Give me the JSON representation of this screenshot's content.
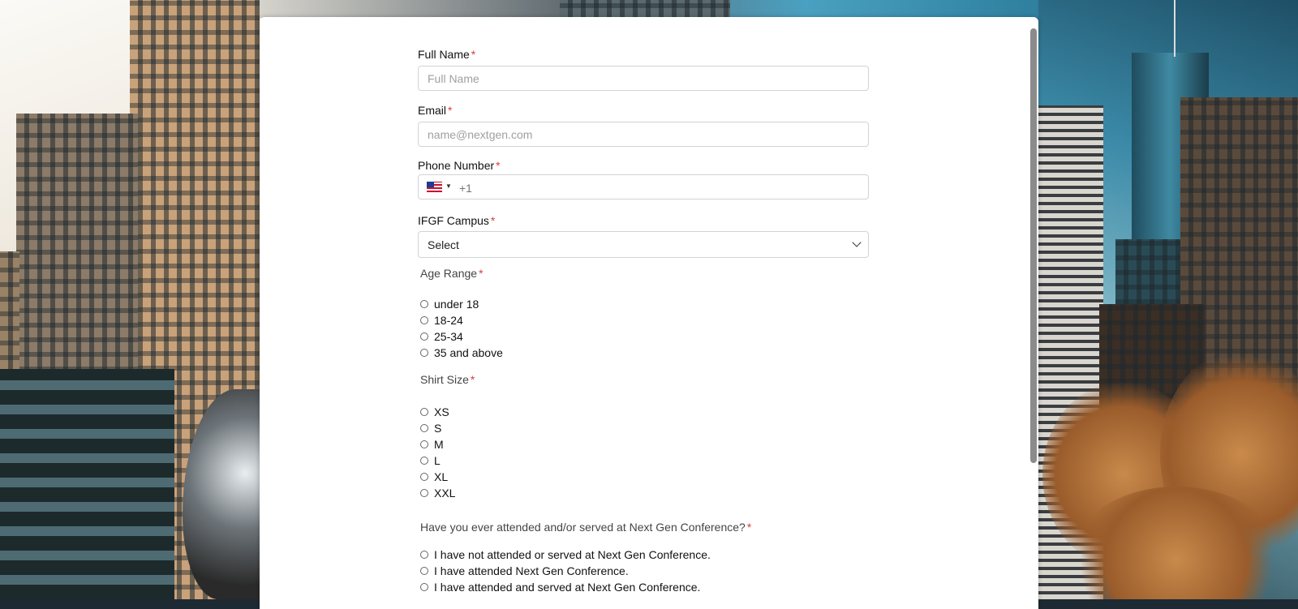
{
  "form": {
    "full_name": {
      "label": "Full Name",
      "required": "*",
      "placeholder": "Full Name"
    },
    "email": {
      "label": "Email",
      "required": "*",
      "placeholder": "name@nextgen.com"
    },
    "phone": {
      "label": "Phone Number",
      "required": "*",
      "country": "United States",
      "dial_code": "+1"
    },
    "campus": {
      "label": "IFGF Campus",
      "required": "*",
      "selected": "Select"
    },
    "age_range": {
      "label": "Age Range",
      "required": "*",
      "options": [
        "under 18",
        "18-24",
        "25-34",
        "35 and above"
      ]
    },
    "shirt_size": {
      "label": "Shirt Size",
      "required": "*",
      "options": [
        "XS",
        "S",
        "M",
        "L",
        "XL",
        "XXL"
      ]
    },
    "attendance": {
      "label": "Have you ever attended and/or served at Next Gen Conference?",
      "required": "*",
      "options": [
        "I have not attended or served at Next Gen Conference.",
        "I have attended Next Gen Conference.",
        "I have attended and served at Next Gen Conference."
      ]
    }
  },
  "colors": {
    "required": "#e03a3a",
    "border": "#d3d3d3"
  },
  "icons": {
    "flag": "us-flag-icon",
    "caret": "caret-down-icon",
    "chevron": "chevron-down-icon"
  }
}
